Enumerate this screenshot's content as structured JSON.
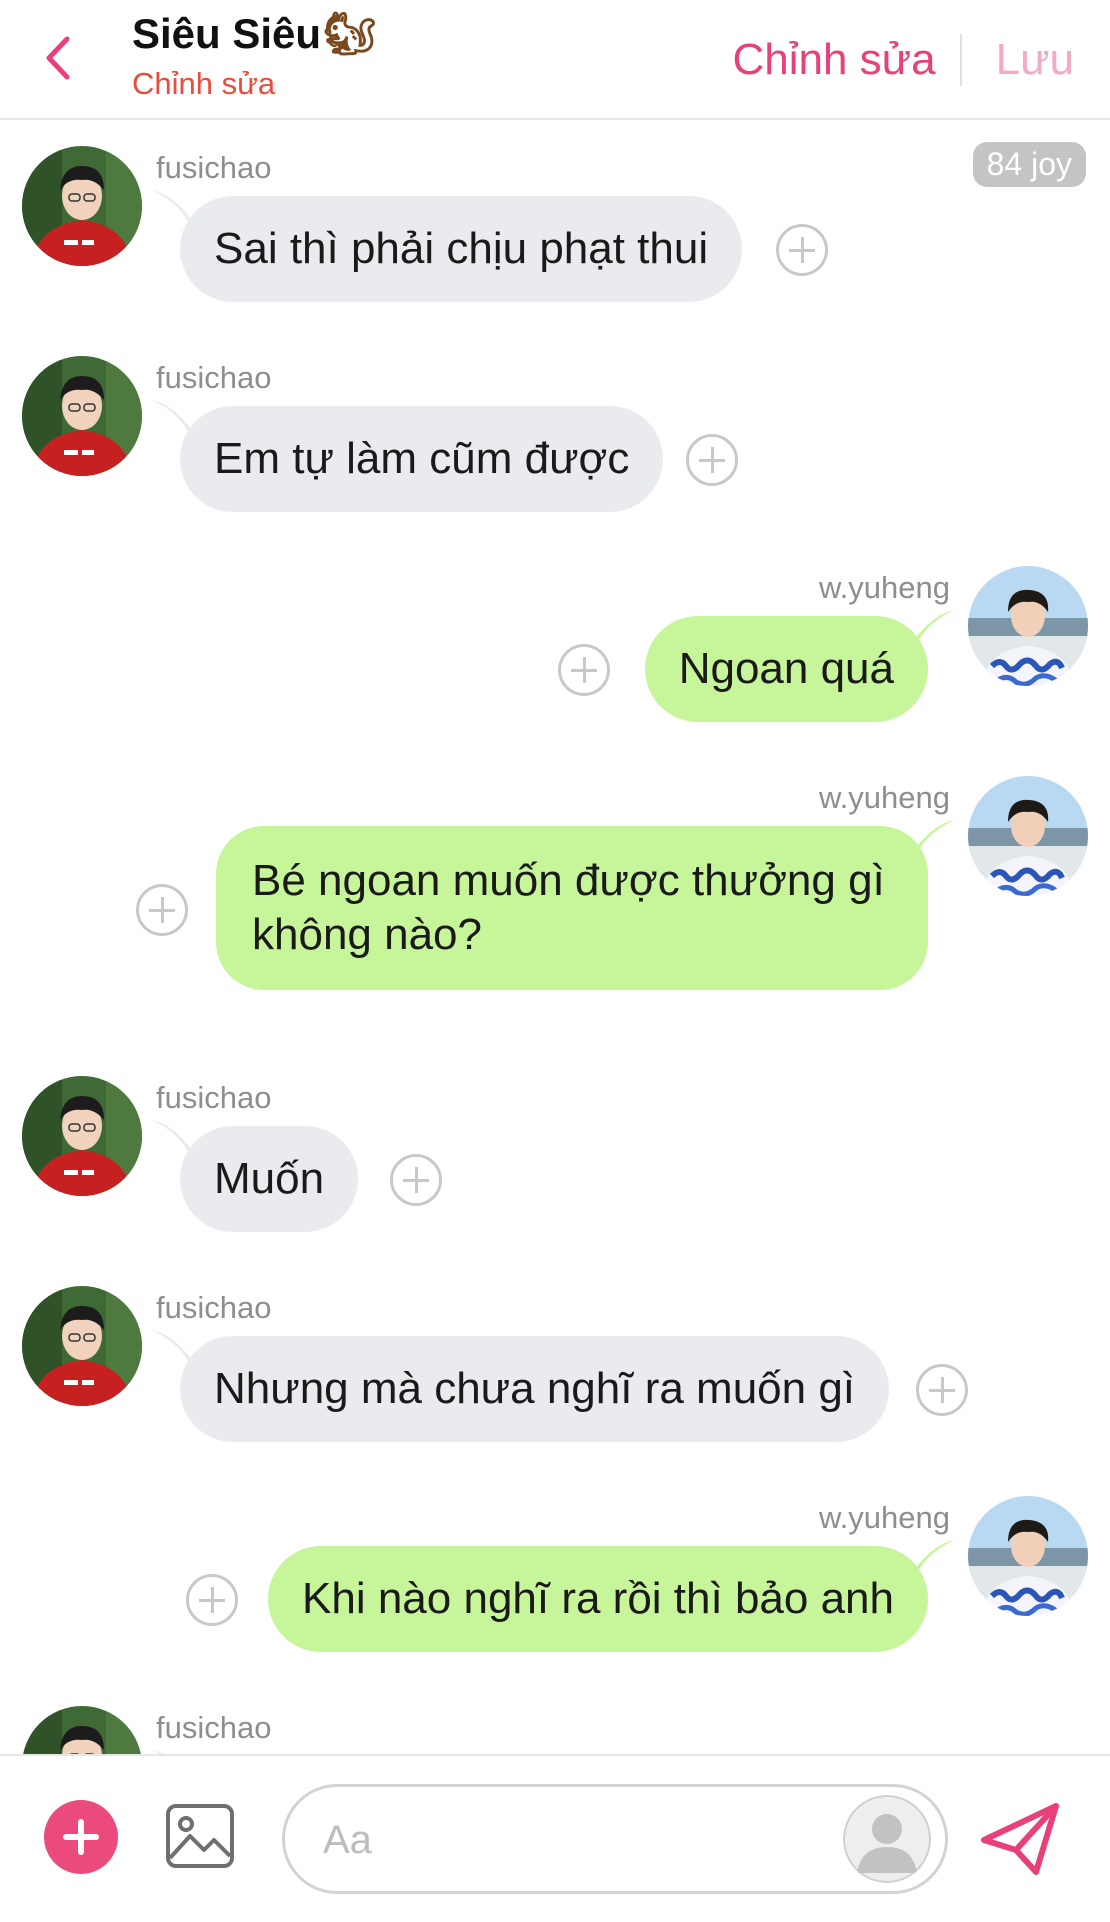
{
  "header": {
    "back_icon": "chevron-left-icon",
    "title": "Siêu Siêu",
    "title_emoji": "🐿",
    "subtitle": "Chỉnh sửa",
    "edit_label": "Chỉnh sửa",
    "save_label": "Lưu"
  },
  "joy_badge": "84 joy",
  "messages": [
    {
      "side": "left",
      "sender": "fusichao",
      "text": "Sai thì phải chịu phạt thui"
    },
    {
      "side": "left",
      "sender": "fusichao",
      "text": "Em tự làm cũm được"
    },
    {
      "side": "right",
      "sender": "w.yuheng",
      "text": "Ngoan quá"
    },
    {
      "side": "right",
      "sender": "w.yuheng",
      "text": "Bé ngoan muốn được thưởng gì không nào?"
    },
    {
      "side": "left",
      "sender": "fusichao",
      "text": "Muốn"
    },
    {
      "side": "left",
      "sender": "fusichao",
      "text": "Nhưng mà chưa nghĩ ra muốn gì"
    },
    {
      "side": "right",
      "sender": "w.yuheng",
      "text": "Khi nào nghĩ ra rồi thì bảo anh"
    },
    {
      "side": "left",
      "sender": "fusichao",
      "text": "😊"
    }
  ],
  "composer": {
    "placeholder": "Aa",
    "add_icon": "plus-icon",
    "image_icon": "image-icon",
    "send_icon": "send-icon"
  },
  "colors": {
    "accent": "#e8407a",
    "left_bubble": "#e9ebee",
    "right_bubble": "#c6f59a",
    "subtitle": "#e84c3d"
  }
}
